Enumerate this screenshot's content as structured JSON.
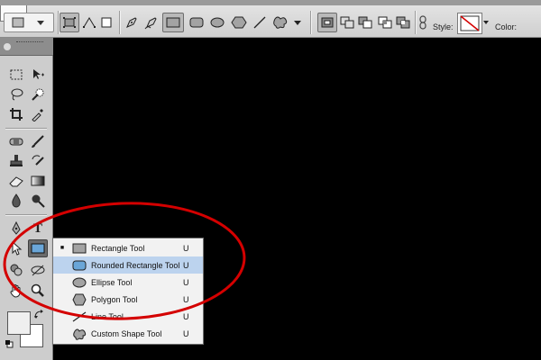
{
  "options_bar": {
    "tool_preset": "rounded-rectangle-tool-preset",
    "mode_buttons": [
      "shape-layers",
      "paths",
      "fill-pixels"
    ],
    "draw_tools": [
      "pen",
      "freeform-pen",
      "rectangle",
      "rounded-rectangle",
      "ellipse",
      "polygon",
      "line",
      "custom-shape"
    ],
    "selected_draw_tool": "rectangle",
    "combine_buttons": [
      "new-layer",
      "add",
      "subtract",
      "intersect",
      "exclude"
    ],
    "style_label": "Style:",
    "color_label": "Color:"
  },
  "flyout": {
    "items": [
      {
        "label": "Rectangle Tool",
        "shortcut": "U",
        "icon": "rectangle-icon",
        "current": true
      },
      {
        "label": "Rounded Rectangle Tool",
        "shortcut": "U",
        "icon": "rounded-rectangle-icon",
        "highlighted": true
      },
      {
        "label": "Ellipse Tool",
        "shortcut": "U",
        "icon": "ellipse-icon"
      },
      {
        "label": "Polygon Tool",
        "shortcut": "U",
        "icon": "polygon-icon"
      },
      {
        "label": "Line Tool",
        "shortcut": "U",
        "icon": "line-icon"
      },
      {
        "label": "Custom Shape Tool",
        "shortcut": "U",
        "icon": "custom-shape-icon"
      }
    ],
    "current_marker": "■"
  },
  "tools_panel": {
    "active_tool": "shape-tool",
    "type_tool_glyph": "T"
  },
  "colors": {
    "annotation": "#d40000",
    "menu_highlight": "#bcd3ee",
    "foreground_swatch": "#efefef",
    "background_swatch": "#ffffff"
  }
}
